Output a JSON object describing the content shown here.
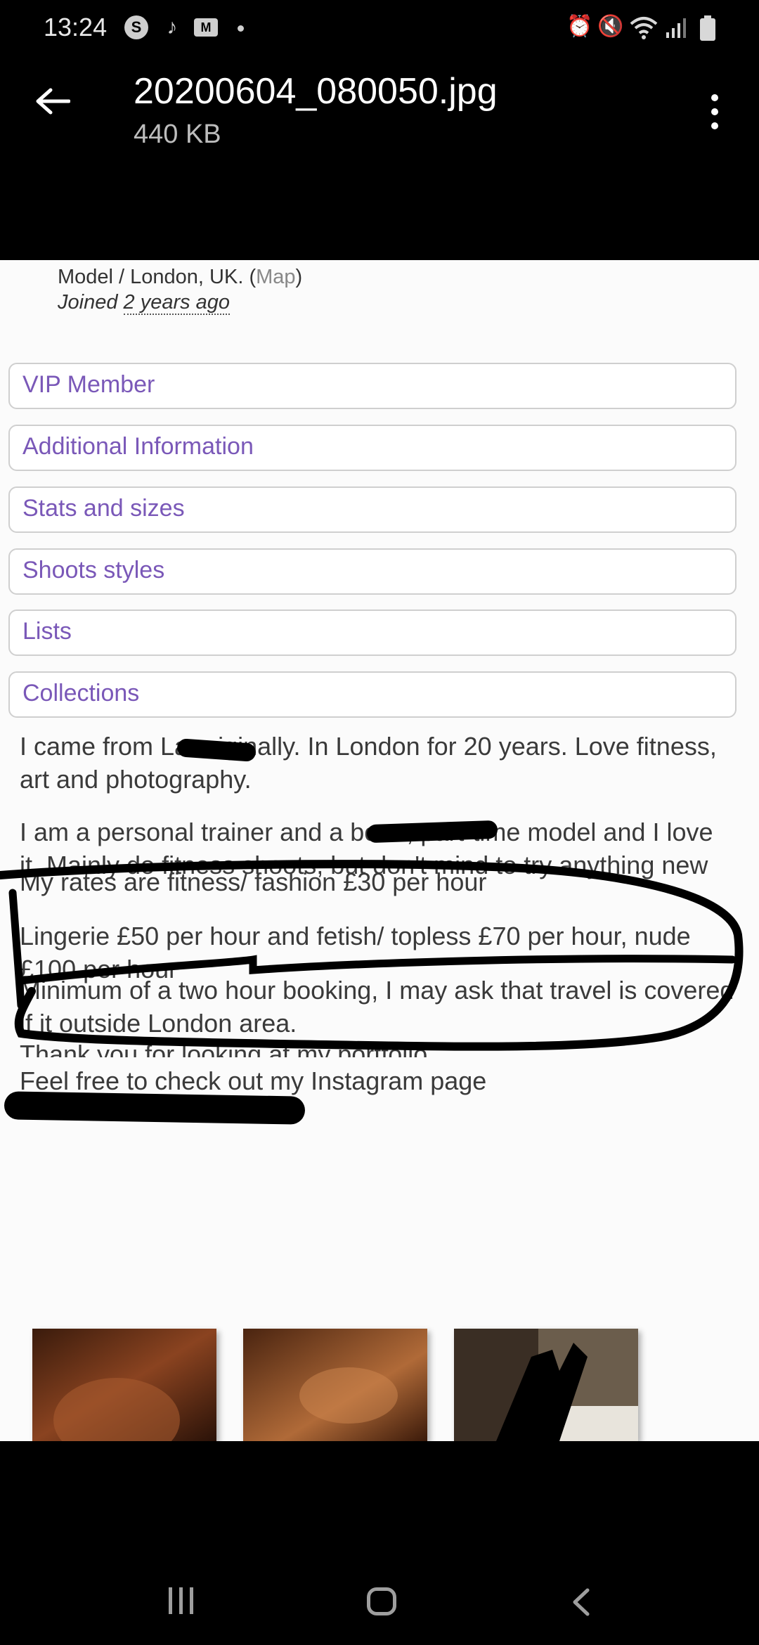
{
  "status_bar": {
    "time": "13:24",
    "notification_icons": [
      "skype-icon",
      "tiktok-icon",
      "gmail-icon",
      "dot-icon"
    ],
    "system_icons": [
      "alarm-icon",
      "mute-icon",
      "wifi-icon",
      "signal-icon",
      "battery-icon"
    ]
  },
  "header": {
    "file_name": "20200604_080050.jpg",
    "file_size": "440 KB"
  },
  "photo": {
    "profile_line_prefix": "Model / London, UK. (",
    "map_link": "Map",
    "profile_line_suffix": ")",
    "joined_label": "Joined ",
    "joined_value": "2 years ago",
    "sections": [
      "VIP Member",
      "Additional Information",
      "Stats and sizes",
      "Shoots styles",
      "Lists",
      "Collections"
    ],
    "paragraphs": [
      " I came from La       originally. In London for 20 years. Love fitness, art and photography.",
      "I am a personal trainer and a bo             er, part-time model and I love it. Mainly do fitness shoots, but don't mind to try anything new",
      "My rates are fitness/ fashion £30 per hour",
      "Lingerie £50 per hour and fetish/ topless £70 per hour, nude £100 per hour",
      "Minimum of a two hour booking, I may ask that travel is covered if it outside London area.",
      "Thank you for looking at my portfolio",
      "Feel free to check out my Instagram page"
    ]
  },
  "navigation": {
    "buttons": [
      "recent-apps",
      "home",
      "back"
    ]
  }
}
